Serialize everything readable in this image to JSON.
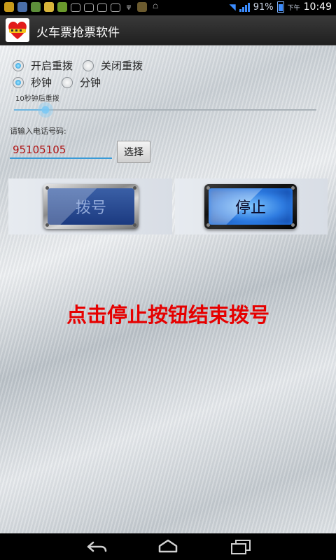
{
  "status_bar": {
    "battery": "91%",
    "ampm": "下午",
    "time": "10:49",
    "notification_icons": [
      "app-icon",
      "chat-icon",
      "image-icon",
      "game-icon",
      "sms-icon",
      "mail-icon",
      "mail-icon",
      "mail-icon",
      "mail-icon",
      "usb-icon",
      "debug-icon",
      "android-icon"
    ]
  },
  "action_bar": {
    "title": "火车票抢票软件"
  },
  "redial": {
    "on_label": "开启重拨",
    "off_label": "关闭重拨",
    "on_selected": true
  },
  "unit": {
    "seconds_label": "秒钟",
    "minutes_label": "分钟",
    "seconds_selected": true
  },
  "seekbar": {
    "label": "10秒钟后重拨",
    "value": 10
  },
  "phone": {
    "label": "请输入电话号码:",
    "value": "95105105",
    "select_label": "选择"
  },
  "buttons": {
    "dial_label": "拨号",
    "stop_label": "停止"
  },
  "hint": {
    "text": "点击停止按钮结束拨号",
    "color": "#e60000"
  },
  "colors": {
    "accent": "#3a9bd7",
    "status_blue": "#3b8cff"
  }
}
